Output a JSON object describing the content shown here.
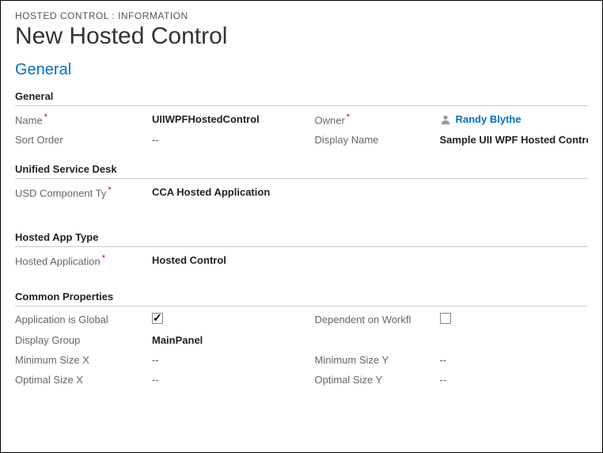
{
  "breadcrumb": "HOSTED CONTROL : INFORMATION",
  "page_title": "New Hosted Control",
  "tab": "General",
  "sections": {
    "general": {
      "header": "General",
      "name_label": "Name",
      "name_value": "UIIWPFHostedControl",
      "owner_label": "Owner",
      "owner_value": "Randy Blythe",
      "sort_order_label": "Sort Order",
      "sort_order_value": "--",
      "display_name_label": "Display Name",
      "display_name_value": "Sample UII WPF Hosted Control"
    },
    "usd": {
      "header": "Unified Service Desk",
      "component_label": "USD Component Ty",
      "component_value": "CCA Hosted Application"
    },
    "hosted_app": {
      "header": "Hosted App Type",
      "hosted_label": "Hosted Application",
      "hosted_value": "Hosted Control"
    },
    "common": {
      "header": "Common Properties",
      "global_label": "Application is Global",
      "global_checked": true,
      "dependent_label": "Dependent on Workfl",
      "dependent_checked": false,
      "display_group_label": "Display Group",
      "display_group_value": "MainPanel",
      "min_x_label": "Minimum Size X",
      "min_x_value": "--",
      "min_y_label": "Minimum Size Y",
      "min_y_value": "--",
      "opt_x_label": "Optimal Size X",
      "opt_x_value": "--",
      "opt_y_label": "Optimal Size Y",
      "opt_y_value": "--"
    }
  }
}
